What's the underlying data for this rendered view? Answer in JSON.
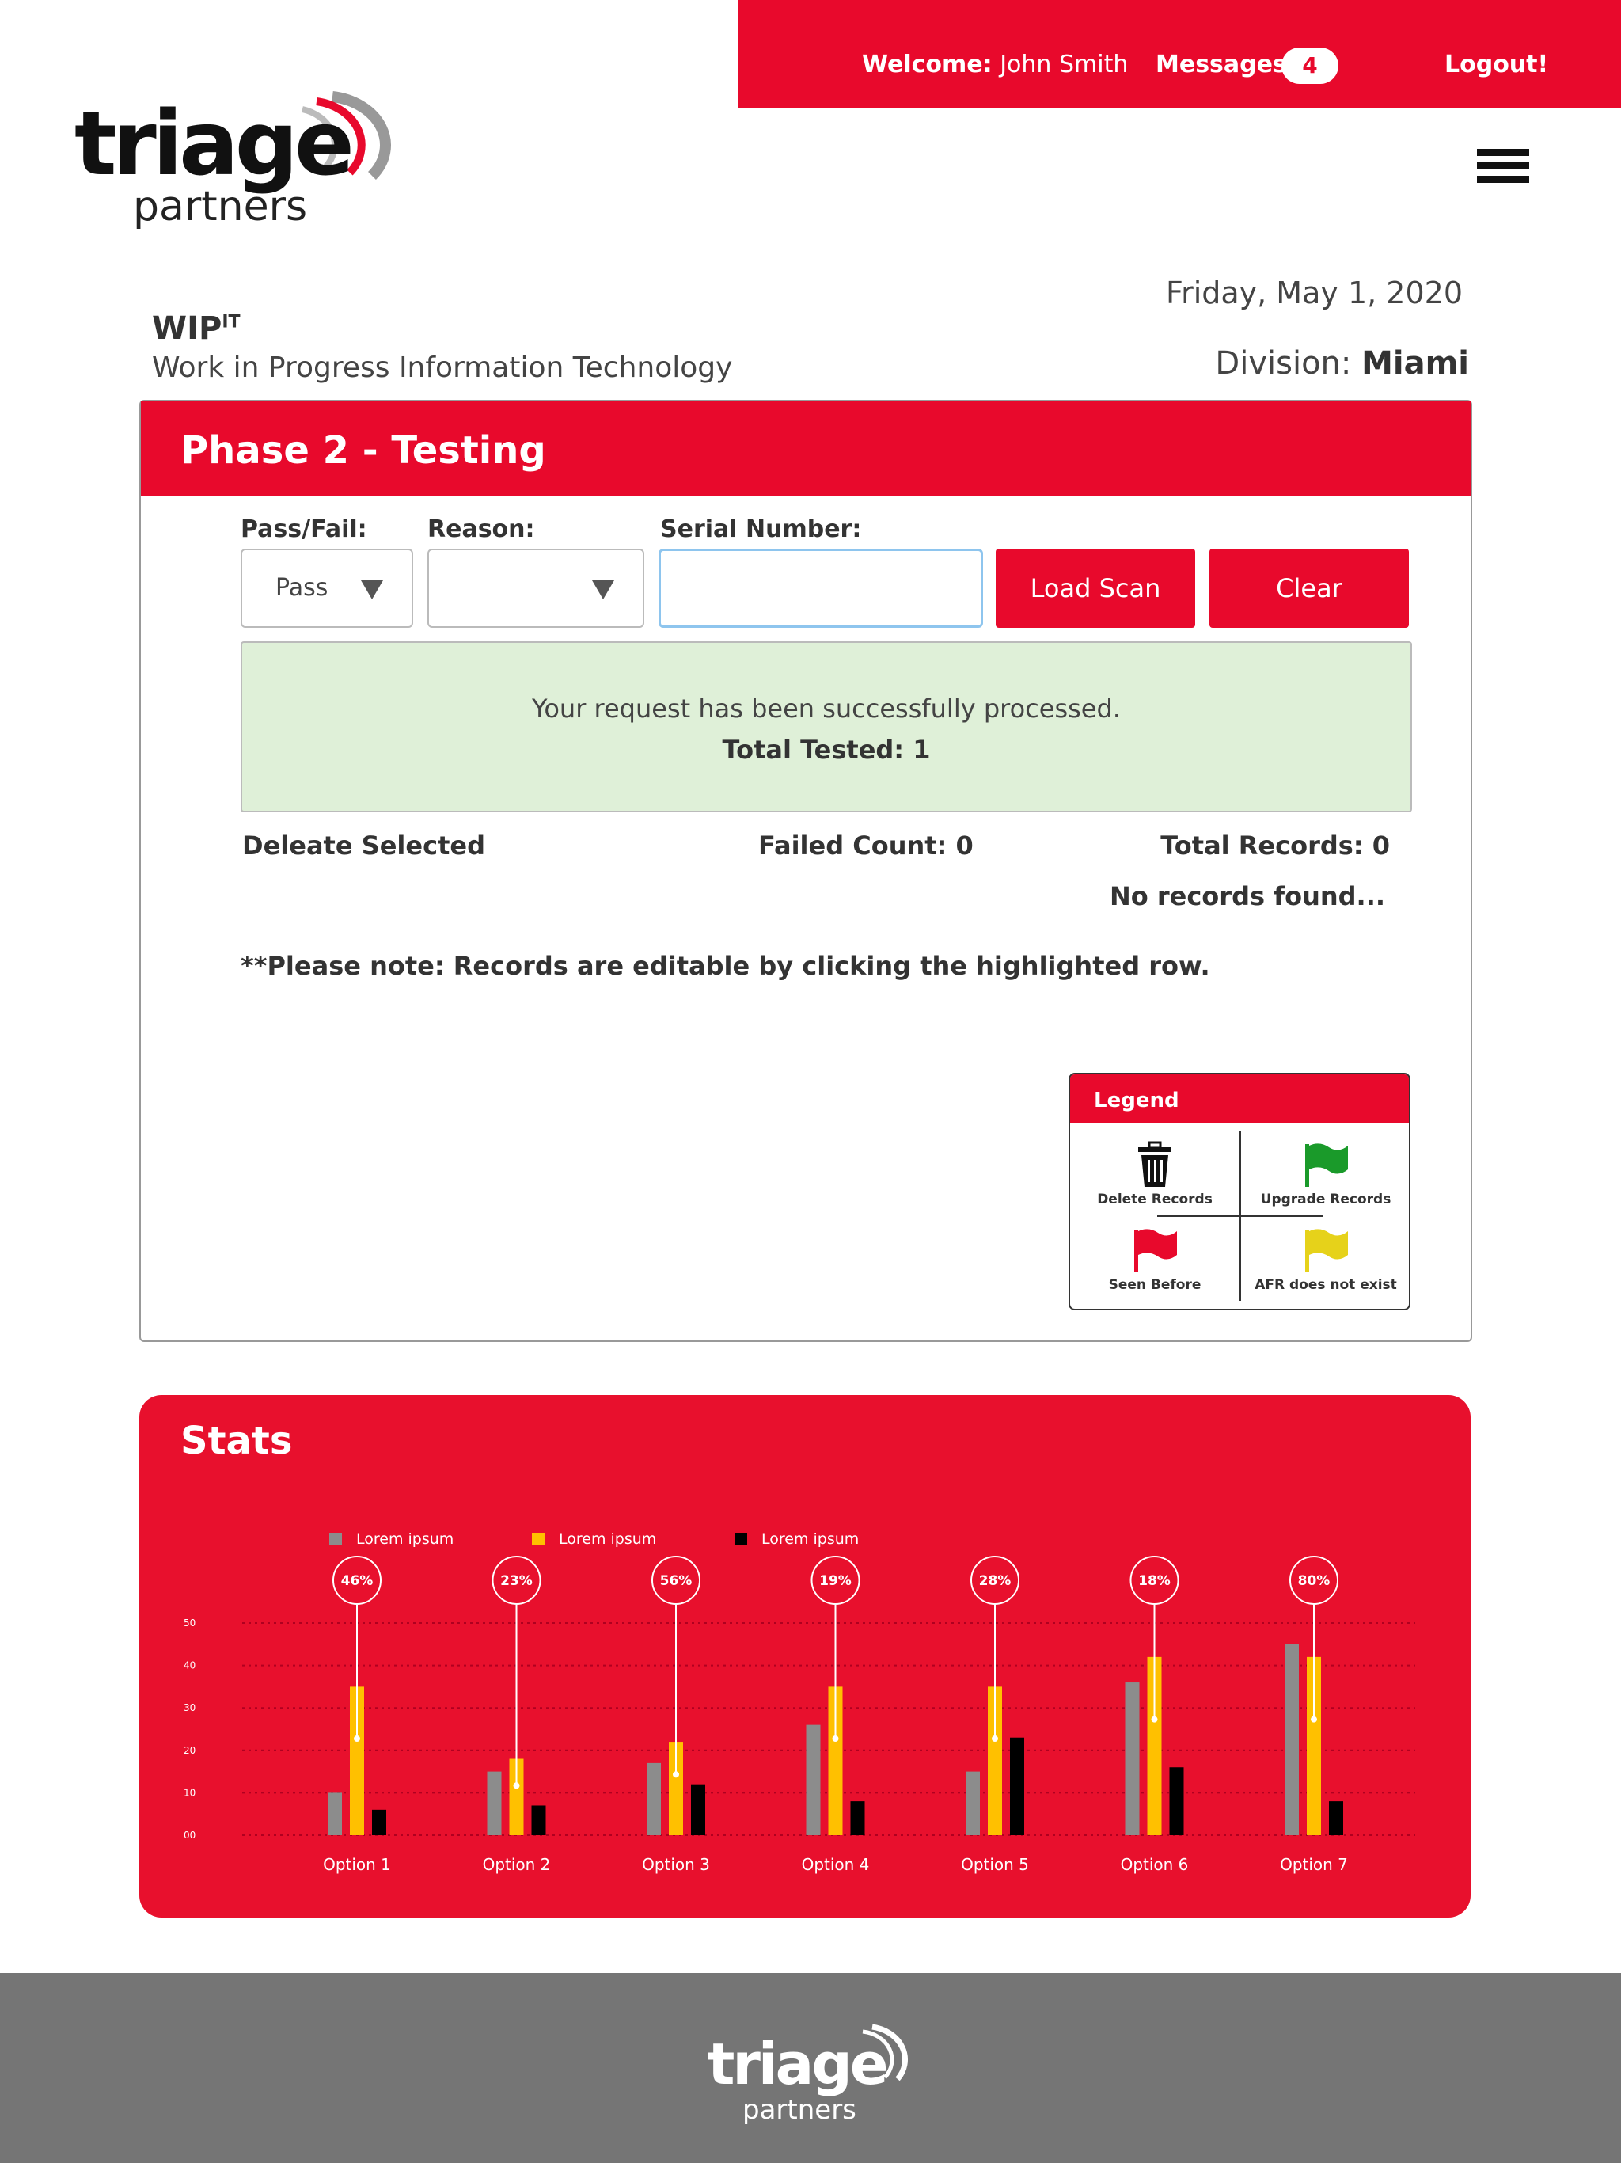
{
  "header": {
    "welcome_label": "Welcome:",
    "user_name": "John Smith",
    "messages_label": "Messages:",
    "messages_count": "4",
    "logout_label": "Logout!"
  },
  "brand": {
    "logo_word": "triage",
    "logo_sub": "partners"
  },
  "page": {
    "date": "Friday, May 1, 2020",
    "division_label": "Division:",
    "division_value": "Miami",
    "app_title": "WIP",
    "app_title_sup": "IT",
    "app_subtitle": "Work in Progress Information Technology"
  },
  "panel": {
    "title": "Phase 2 - Testing",
    "passfail_label": "Pass/Fail:",
    "passfail_value": "Pass",
    "reason_label": "Reason:",
    "reason_value": "",
    "serial_label": "Serial Number:",
    "serial_value": "",
    "load_scan_label": "Load Scan",
    "clear_label": "Clear",
    "success_message": "Your request has been successfully processed.",
    "total_tested": "Total Tested: 1",
    "delete_selected": "Deleate Selected",
    "failed_count": "Failed Count: 0",
    "total_records": "Total Records: 0",
    "no_records": "No records found...",
    "note": "**Please note: Records are editable by clicking the highlighted row."
  },
  "legend": {
    "title": "Legend",
    "items": [
      {
        "label": "Delete Records",
        "icon": "trash-icon"
      },
      {
        "label": "Upgrade Records",
        "icon": "green-flag-icon",
        "color": "#1a9a2a"
      },
      {
        "label": "Seen Before",
        "icon": "red-flag-icon",
        "color": "#e8092c"
      },
      {
        "label": "AFR does not exist",
        "icon": "yellow-flag-icon",
        "color": "#e6d21a"
      }
    ]
  },
  "stats": {
    "title": "Stats"
  },
  "colors": {
    "accent": "#e8092c",
    "footer": "#757575",
    "success_bg": "#dff0d8"
  },
  "chart_data": {
    "type": "bar",
    "categories": [
      "Option 1",
      "Option 2",
      "Option 3",
      "Option 4",
      "Option 5",
      "Option 6",
      "Option 7"
    ],
    "series": [
      {
        "name": "Lorem ipsum",
        "color": "#8c8c8c",
        "values": [
          10,
          15,
          17,
          26,
          15,
          36,
          45
        ]
      },
      {
        "name": "Lorem ipsum",
        "color": "#ffc000",
        "values": [
          35,
          18,
          22,
          35,
          35,
          42,
          42
        ]
      },
      {
        "name": "Lorem ipsum",
        "color": "#000000",
        "values": [
          6,
          7,
          12,
          8,
          23,
          16,
          8
        ]
      }
    ],
    "percent_labels": [
      "46%",
      "23%",
      "56%",
      "19%",
      "28%",
      "18%",
      "80%"
    ],
    "yticks": [
      "00",
      "10",
      "20",
      "30",
      "40",
      "50"
    ],
    "ylim": [
      0,
      50
    ],
    "grid": true,
    "legend_position": "top-left"
  }
}
